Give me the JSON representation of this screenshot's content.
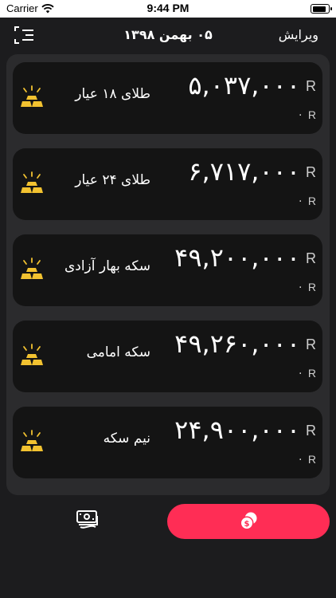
{
  "status_bar": {
    "carrier": "Carrier",
    "time": "9:44 PM",
    "battery_level": 0.9
  },
  "nav": {
    "title": "۰۵ بهمن ۱۳۹۸",
    "edit_label": "ویرایش",
    "menu_icon": "menu-icon"
  },
  "items": [
    {
      "name": "طلای ۱۸ عیار",
      "price": "۵,۰۳۷,۰۰۰",
      "price_unit": "R",
      "change": "۰",
      "change_unit": "R",
      "icon": "gold-bars-icon"
    },
    {
      "name": "طلای ۲۴ عیار",
      "price": "۶,۷۱۷,۰۰۰",
      "price_unit": "R",
      "change": "۰",
      "change_unit": "R",
      "icon": "gold-bars-icon"
    },
    {
      "name": "سکه بهار آزادی",
      "price": "۴۹,۲۰۰,۰۰۰",
      "price_unit": "R",
      "change": "۰",
      "change_unit": "R",
      "icon": "gold-bars-icon"
    },
    {
      "name": "سکه امامی",
      "price": "۴۹,۲۶۰,۰۰۰",
      "price_unit": "R",
      "change": "۰",
      "change_unit": "R",
      "icon": "gold-bars-icon"
    },
    {
      "name": "نیم سکه",
      "price": "۲۴,۹۰۰,۰۰۰",
      "price_unit": "R",
      "change": "۰",
      "change_unit": "R",
      "icon": "gold-bars-icon"
    }
  ],
  "tabs": [
    {
      "icon": "money-icon",
      "selected": false
    },
    {
      "icon": "coins-icon",
      "selected": true
    }
  ],
  "colors": {
    "accent": "#ff2d55",
    "gold": "#f2c230",
    "background": "#1c1c1e",
    "panel": "#2b2b2d",
    "card": "#141414"
  }
}
